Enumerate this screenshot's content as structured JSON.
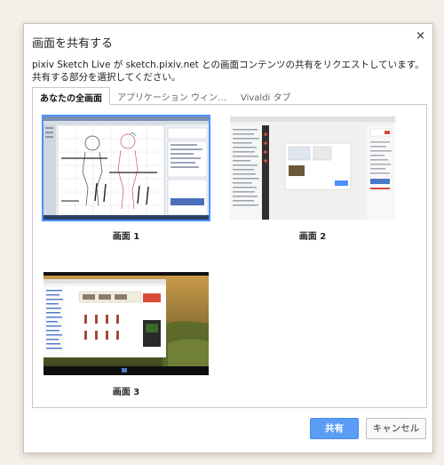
{
  "dialog": {
    "title": "画面を共有する",
    "close_glyph": "×",
    "description": "pixiv Sketch Live が sketch.pixiv.net との画面コンテンツの共有をリクエストしています。共有する部分を選択してください。"
  },
  "tabs": [
    {
      "label": "あなたの全画面",
      "active": true
    },
    {
      "label": "アプリケーション ウィン…",
      "active": false
    },
    {
      "label": "Vivaldi タブ",
      "active": false
    }
  ],
  "screens": [
    {
      "caption": "画面 1",
      "selected": true
    },
    {
      "caption": "画面 2",
      "selected": false
    },
    {
      "caption": "画面 3",
      "selected": false
    }
  ],
  "buttons": {
    "share_label": "共有",
    "cancel_label": "キャンセル"
  },
  "colors": {
    "accent": "#4d90fe",
    "primary_button": "#5b9cf7"
  }
}
